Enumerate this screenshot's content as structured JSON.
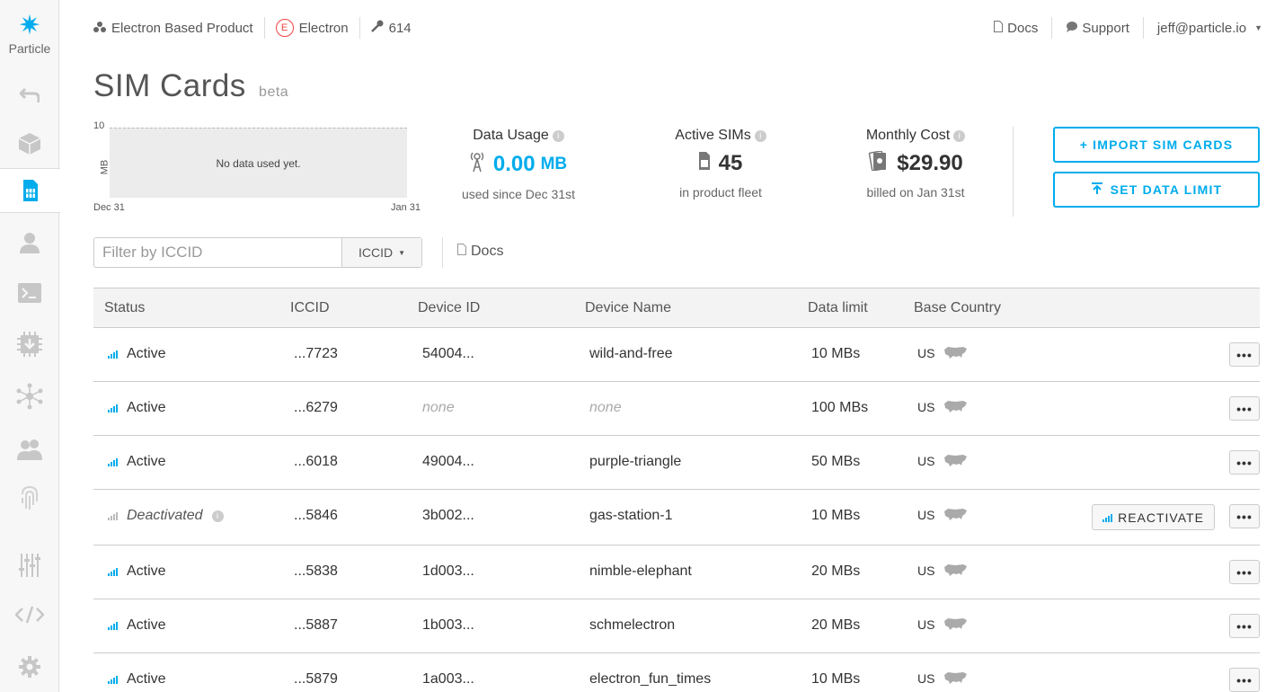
{
  "brand": {
    "name": "Particle"
  },
  "topnav": {
    "product": "Electron Based Product",
    "platform_badge": "E",
    "platform": "Electron",
    "product_id": "614",
    "docs": "Docs",
    "support": "Support",
    "user": "jeff@particle.io"
  },
  "page": {
    "title": "SIM Cards",
    "badge": "beta"
  },
  "chart_data": {
    "type": "area",
    "ymax_label": "10",
    "ylabel": "MB",
    "x_start": "Dec 31",
    "x_end": "Jan 31",
    "empty_message": "No data used yet.",
    "series": []
  },
  "stats": {
    "data_usage": {
      "label": "Data Usage",
      "value": "0.00",
      "unit": "MB",
      "sub": "used since Dec 31st"
    },
    "active_sims": {
      "label": "Active SIMs",
      "value": "45",
      "sub": "in product fleet"
    },
    "monthly_cost": {
      "label": "Monthly Cost",
      "value": "$29.90",
      "sub": "billed on Jan 31st"
    }
  },
  "actions": {
    "import": "+ IMPORT SIM CARDS",
    "set_limit": "SET DATA LIMIT"
  },
  "filter": {
    "placeholder": "Filter by ICCID",
    "select_value": "ICCID",
    "docs": "Docs"
  },
  "table": {
    "headers": [
      "Status",
      "ICCID",
      "Device ID",
      "Device Name",
      "Data limit",
      "Base Country"
    ],
    "rows": [
      {
        "status": "Active",
        "iccid": "...7723",
        "device_id": "54004...",
        "device_name": "wild-and-free",
        "limit": "10 MBs",
        "country": "US"
      },
      {
        "status": "Active",
        "iccid": "...6279",
        "device_id": "none",
        "device_name": "none",
        "limit": "100 MBs",
        "country": "US"
      },
      {
        "status": "Active",
        "iccid": "...6018",
        "device_id": "49004...",
        "device_name": "purple-triangle",
        "limit": "50 MBs",
        "country": "US"
      },
      {
        "status": "Deactivated",
        "iccid": "...5846",
        "device_id": "3b002...",
        "device_name": "gas-station-1",
        "limit": "10 MBs",
        "country": "US",
        "action": "REACTIVATE"
      },
      {
        "status": "Active",
        "iccid": "...5838",
        "device_id": "1d003...",
        "device_name": "nimble-elephant",
        "limit": "20 MBs",
        "country": "US"
      },
      {
        "status": "Active",
        "iccid": "...5887",
        "device_id": "1b003...",
        "device_name": "schmelectron",
        "limit": "20 MBs",
        "country": "US"
      },
      {
        "status": "Active",
        "iccid": "...5879",
        "device_id": "1a003...",
        "device_name": "electron_fun_times",
        "limit": "10 MBs",
        "country": "US"
      }
    ],
    "more_label": "•••"
  }
}
